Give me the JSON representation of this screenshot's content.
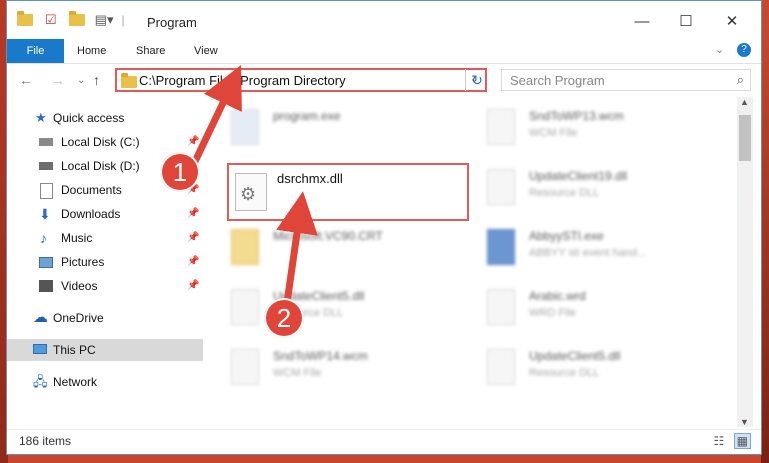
{
  "window": {
    "title": "Program"
  },
  "ribbon": {
    "tabs": [
      "File",
      "Home",
      "Share",
      "View"
    ]
  },
  "address": {
    "path": "C:\\Program Files\\Program Directory"
  },
  "search": {
    "placeholder": "Search Program"
  },
  "sidebar": {
    "items": [
      {
        "label": "Quick access",
        "icon": "star-icon"
      },
      {
        "label": "Local Disk (C:)",
        "icon": "drive-icon"
      },
      {
        "label": "Local Disk (D:)",
        "icon": "drive-icon"
      },
      {
        "label": "Documents",
        "icon": "documents-icon"
      },
      {
        "label": "Downloads",
        "icon": "download-icon"
      },
      {
        "label": "Music",
        "icon": "music-icon"
      },
      {
        "label": "Pictures",
        "icon": "pictures-icon"
      },
      {
        "label": "Videos",
        "icon": "videos-icon"
      },
      {
        "label": "OneDrive",
        "icon": "cloud-icon"
      },
      {
        "label": "This PC",
        "icon": "computer-icon"
      },
      {
        "label": "Network",
        "icon": "network-icon"
      }
    ]
  },
  "files": {
    "selected": {
      "name": "dsrchmx.dll"
    },
    "left": [
      {
        "name": "program.exe",
        "type": ""
      },
      {
        "name": "Microsoft.VC90.CRT",
        "type": ""
      },
      {
        "name": "UpdateClient5.dll",
        "type": "Resource DLL"
      },
      {
        "name": "SndToWP14.wcm",
        "type": "WCM File"
      }
    ],
    "right": [
      {
        "name": "SndToWP13.wcm",
        "type": "WCM File"
      },
      {
        "name": "UpdateClient19.dll",
        "type": "Resource DLL"
      },
      {
        "name": "AbbyySTI.exe",
        "type": "ABBYY sti event hand..."
      },
      {
        "name": "Arabic.wrd",
        "type": "WRD File"
      },
      {
        "name": "UpdateClient5.dll",
        "type": "Resource DLL"
      }
    ]
  },
  "status": {
    "items": "186 items"
  },
  "callouts": {
    "one": "1",
    "two": "2"
  },
  "colors": {
    "accent": "#1979ca",
    "highlight": "#e25b5b",
    "badge": "#e0453a"
  }
}
